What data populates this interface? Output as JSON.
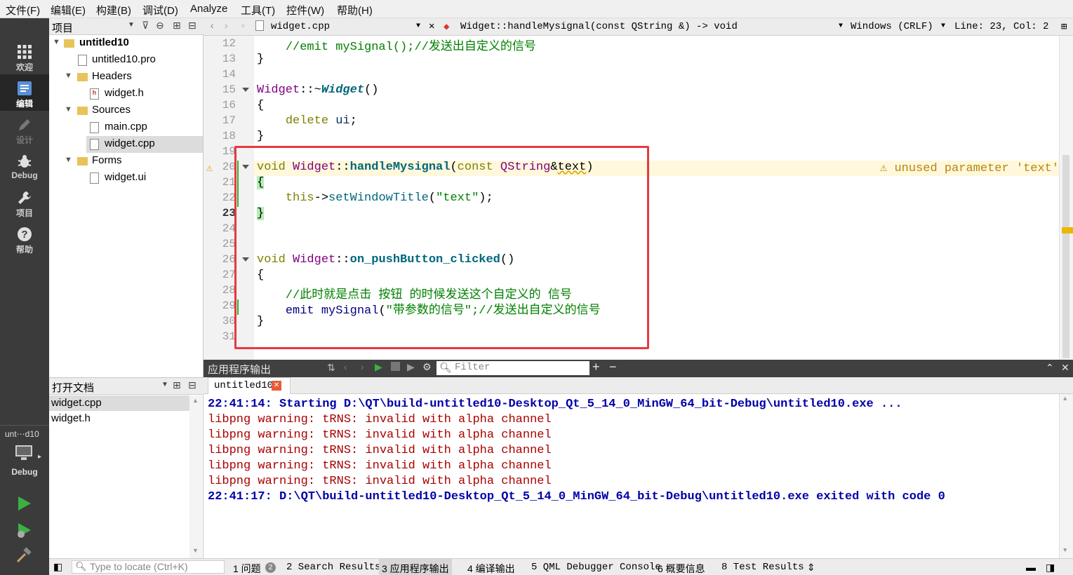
{
  "menu": [
    "文件(F)",
    "编辑(E)",
    "构建(B)",
    "调试(D)",
    "Analyze",
    "工具(T)",
    "控件(W)",
    "帮助(H)"
  ],
  "modes": [
    {
      "label": "欢迎",
      "icon": "grid-icon"
    },
    {
      "label": "编辑",
      "icon": "edit-icon"
    },
    {
      "label": "设计",
      "icon": "pencil-icon"
    },
    {
      "label": "Debug",
      "icon": "bug-icon"
    },
    {
      "label": "项目",
      "icon": "wrench-icon"
    },
    {
      "label": "帮助",
      "icon": "help-icon"
    }
  ],
  "kit": {
    "target": "unt⋯d10",
    "config": "Debug"
  },
  "project_pane": {
    "title": "项目",
    "tree": {
      "project": "untitled10",
      "pro_file": "untitled10.pro",
      "headers": "Headers",
      "header_file": "widget.h",
      "sources": "Sources",
      "source_main": "main.cpp",
      "source_widget": "widget.cpp",
      "forms": "Forms",
      "form_file": "widget.ui"
    }
  },
  "open_docs": {
    "title": "打开文档",
    "items": [
      "widget.cpp",
      "widget.h"
    ]
  },
  "editor_toolbar": {
    "file": "widget.cpp",
    "symbol": "Widget::handleMysignal(const QString &) -> void",
    "line_ending": "Windows (CRLF)",
    "position": "Line: 23, Col: 2"
  },
  "editor": {
    "line_numbers": [
      "12",
      "13",
      "14",
      "15",
      "16",
      "17",
      "18",
      "19",
      "20",
      "21",
      "22",
      "23",
      "24",
      "25",
      "26",
      "27",
      "28",
      "29",
      "30",
      "31"
    ],
    "warning": "unused parameter 'text'",
    "comment_emit": "//emit mySignal();//发送出自定义的信号",
    "comment_click": "//此时就是点击 按钮 的时候发送这个自定义的 信号",
    "emit_string": "\"带参数的信号\"",
    "emit_comment": ";//发送出自定义的信号",
    "title_string": "\"text\""
  },
  "output": {
    "header": "应用程序输出",
    "filter_placeholder": "Filter",
    "tab": "untitled10",
    "lines": [
      {
        "text": "22:41:14: Starting D:\\QT\\build-untitled10-Desktop_Qt_5_14_0_MinGW_64_bit-Debug\\untitled10.exe ...",
        "kind": "info"
      },
      {
        "text": "libpng warning: tRNS: invalid with alpha channel",
        "kind": "warn"
      },
      {
        "text": "libpng warning: tRNS: invalid with alpha channel",
        "kind": "warn"
      },
      {
        "text": "libpng warning: tRNS: invalid with alpha channel",
        "kind": "warn"
      },
      {
        "text": "libpng warning: tRNS: invalid with alpha channel",
        "kind": "warn"
      },
      {
        "text": "libpng warning: tRNS: invalid with alpha channel",
        "kind": "warn"
      },
      {
        "text": "22:41:17: D:\\QT\\build-untitled10-Desktop_Qt_5_14_0_MinGW_64_bit-Debug\\untitled10.exe exited with code 0",
        "kind": "info"
      }
    ]
  },
  "statusbar": {
    "locate_placeholder": "Type to locate (Ctrl+K)",
    "tabs": [
      "1 问题",
      "2 Search Results",
      "3 应用程序输出",
      "4 编译输出",
      "5 QML Debugger Console",
      "6 概要信息",
      "8 Test Results"
    ],
    "issues_count": "2"
  },
  "colors": {
    "highlight_box": "#e8393f",
    "mode_bar": "#3b3b3b",
    "output_header": "#404040"
  }
}
